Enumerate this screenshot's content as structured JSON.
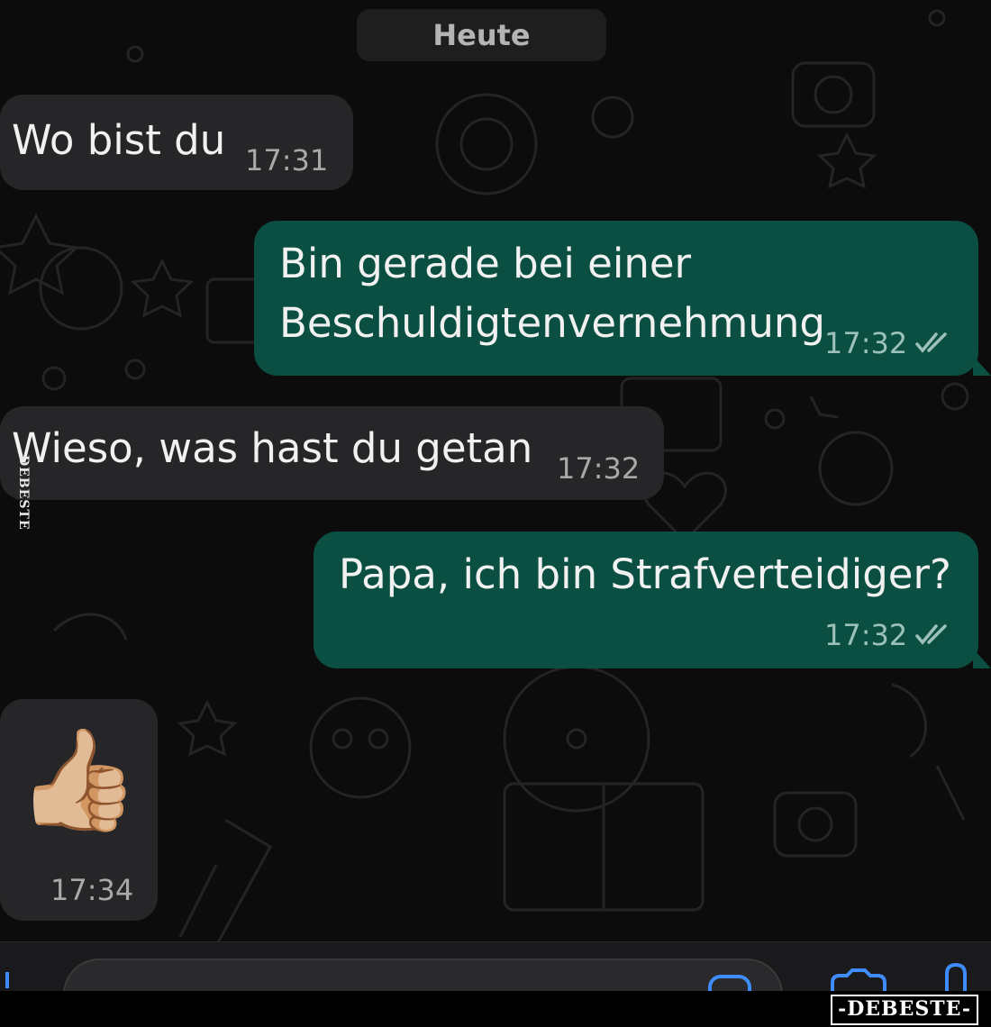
{
  "date_separator": "Heute",
  "messages": [
    {
      "direction": "incoming",
      "text": "Wo bist du",
      "time": "17:31"
    },
    {
      "direction": "outgoing",
      "lines": [
        "Bin gerade bei einer",
        "Beschuldigtenvernehmung"
      ],
      "time": "17:32",
      "status": "read"
    },
    {
      "direction": "incoming",
      "text": "Wieso, was hast du getan",
      "time": "17:32"
    },
    {
      "direction": "outgoing",
      "text": "Papa, ich bin Strafverteidiger?",
      "time": "17:32",
      "status": "read"
    },
    {
      "direction": "incoming",
      "emoji": "👍🏼",
      "time": "17:34"
    }
  ],
  "watermark": {
    "side": "DEBESTE",
    "logo": "-DEBESTE-"
  },
  "colors": {
    "incoming_bubble": "#262628",
    "outgoing_bubble": "#0b4f42",
    "background": "#0c0c0c"
  }
}
